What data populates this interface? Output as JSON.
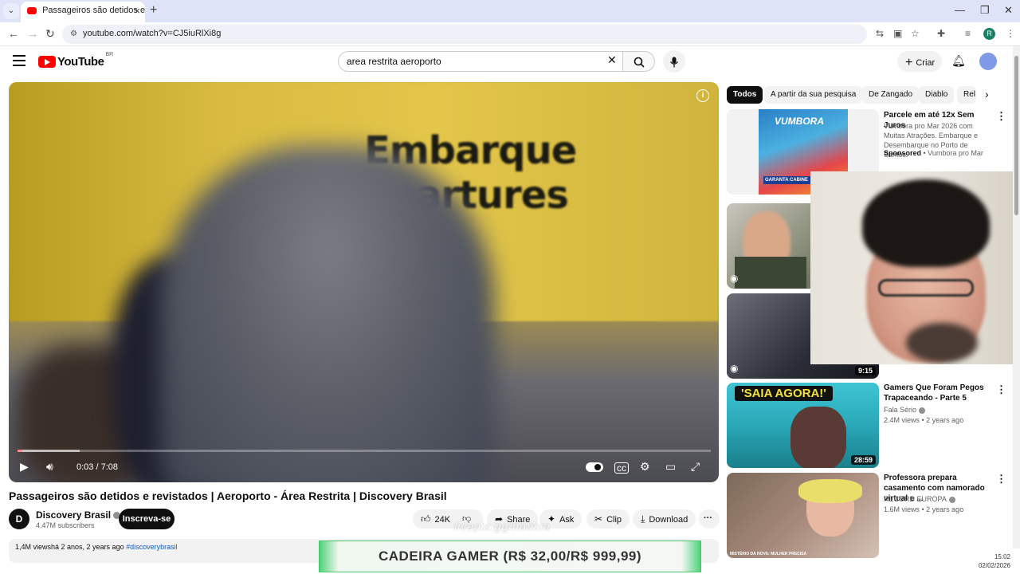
{
  "browser": {
    "tab_title": "Passageiros são detidos e revist",
    "url": "youtube.com/watch?v=CJ5iuRlXi8g",
    "profile_initial": "R"
  },
  "header": {
    "logo_text": "YouTube",
    "country_code": "BR",
    "search_value": "area restrita aeroporto",
    "create_label": "Criar"
  },
  "player": {
    "sign_line1": "Embarque",
    "sign_line2": "epartures",
    "time": "0:03 / 7:08",
    "progress_fraction": 0.007,
    "buffer_fraction": 0.09
  },
  "video": {
    "title": "Passageiros são detidos e revistados | Aeroporto - Área Restrita | Discovery Brasil",
    "channel": "Discovery Brasil",
    "subscribers": "4.47M subscribers",
    "subscribe_label": "Inscreva-se",
    "likes": "24K",
    "share_label": "Share",
    "ask_label": "Ask",
    "clip_label": "Clip",
    "download_label": "Download",
    "desc_stats": "1,4M viewshá 2 anos, 2 years ago",
    "desc_tag": "#discoverybrasil"
  },
  "chips": [
    "Todos",
    "A partir da sua pesquisa",
    "De Zangado",
    "Diablo",
    "Rel"
  ],
  "sidebar": [
    {
      "title": "Parcele em até 12x Sem Juros",
      "desc": "Vumbora pro Mar 2026 com Muitas Atrações. Embarque e Desembarque no Porto de Santos.",
      "sponsored": "Sponsored",
      "advertiser": "Vumbora pro Mar",
      "thumb_text": "VUMBORA",
      "thumb_sub": "GARANTA CABINE"
    },
    {
      "title": "",
      "duration": ""
    },
    {
      "title": "",
      "duration": "9:15"
    },
    {
      "title": "Gamers Que Foram Pegos Trapaceando - Parte 5",
      "channel": "Fala Sério",
      "meta": "2.4M views • 2 years ago",
      "duration": "28:59",
      "thumb_text": "'SAIA AGORA!'"
    },
    {
      "title": "Professora prepara casamento com namorado virtual e ...",
      "channel": "RECORD EUROPA",
      "meta": "1.6M views • 2 years ago",
      "thumb_text": "MISTÉRIO DA NOVA: MULHER PRECISA"
    }
  ],
  "overlay": {
    "watermark": "livepix.gg/noticia",
    "banner": "CADEIRA GAMER (R$ 32,00/R$ 999,99)"
  },
  "taskbar": {
    "time": "15:02",
    "date": "02/02/2026"
  },
  "colors": {
    "brand": "#ff0000",
    "chip_active": "#0f0f0f",
    "banner_accent": "#4cc36f"
  }
}
